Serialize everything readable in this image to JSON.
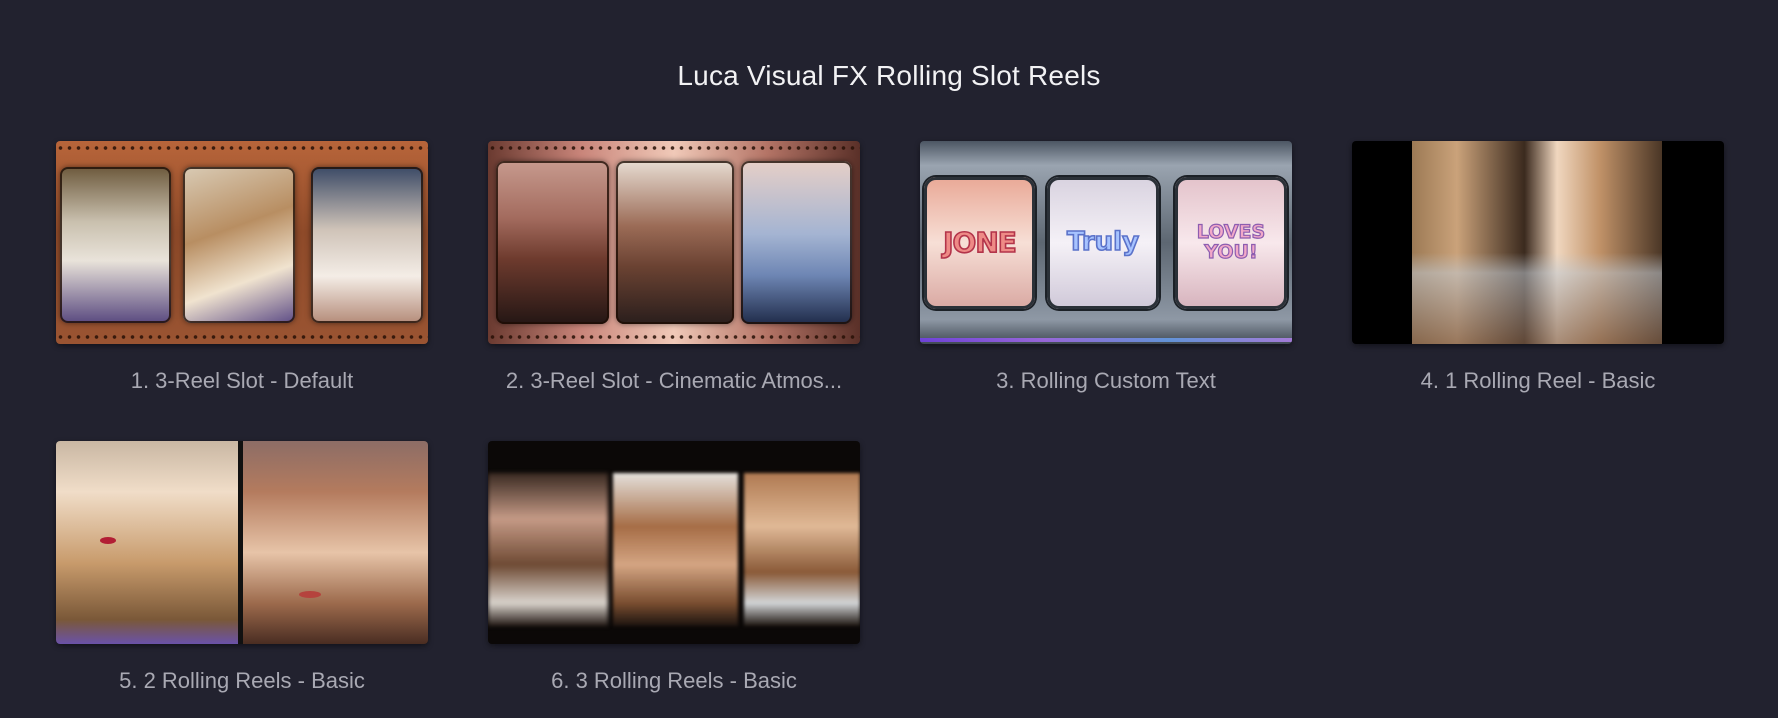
{
  "page": {
    "title": "Luca Visual FX Rolling Slot Reels"
  },
  "presets": [
    {
      "label": "1. 3-Reel Slot - Default"
    },
    {
      "label": "2. 3-Reel Slot - Cinematic Atmos..."
    },
    {
      "label": "3. Rolling Custom Text",
      "reel_texts": [
        "JONE",
        "Truly",
        "LOVES YOU!"
      ]
    },
    {
      "label": "4. 1 Rolling Reel - Basic"
    },
    {
      "label": "5. 2 Rolling Reels - Basic"
    },
    {
      "label": "6. 3 Rolling Reels - Basic"
    }
  ],
  "colors": {
    "background": "#22222f",
    "title_text": "#f2f2f4",
    "caption_text": "#a9a9b3"
  }
}
